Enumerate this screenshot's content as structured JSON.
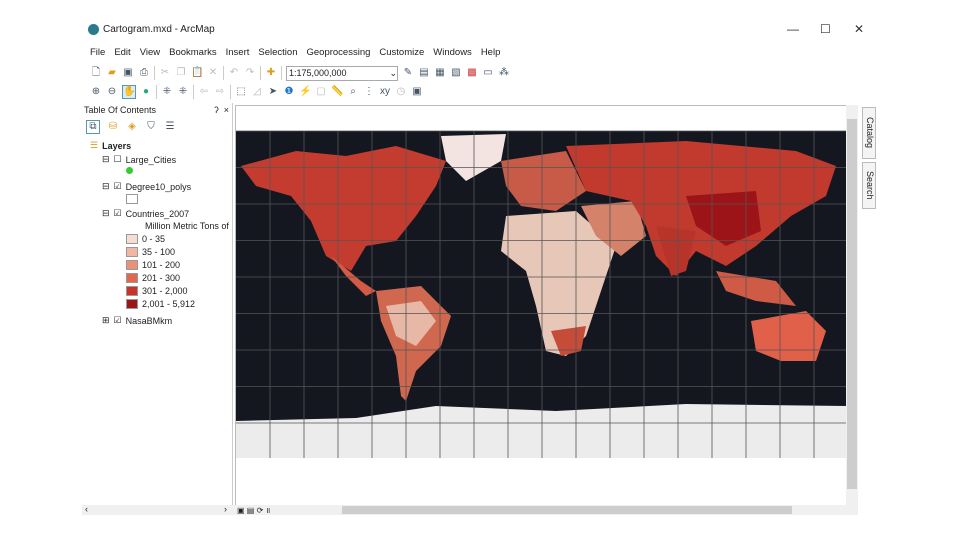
{
  "window": {
    "title": "Cartogram.mxd - ArcMap",
    "minimize": "—",
    "maximize": "☐",
    "close": "✕"
  },
  "menu": [
    "File",
    "Edit",
    "View",
    "Bookmarks",
    "Insert",
    "Selection",
    "Geoprocessing",
    "Customize",
    "Windows",
    "Help"
  ],
  "toolbar": {
    "scale": "1:175,000,000"
  },
  "toc": {
    "title": "Table Of Contents",
    "pin": "ʔ",
    "close": "×",
    "root": "Layers",
    "layers": [
      {
        "name": "Large_Cities",
        "checked": false
      },
      {
        "name": "Degree10_polys",
        "checked": true
      },
      {
        "name": "Countries_2007",
        "checked": true
      },
      {
        "name": "NasaBMkm",
        "checked": true
      }
    ],
    "legend_title": "Million Metric Tons of",
    "legend": [
      {
        "label": "0 - 35",
        "color": "#f6dcd4"
      },
      {
        "label": "35 - 100",
        "color": "#f0b8a4"
      },
      {
        "label": "101 - 200",
        "color": "#ec9178"
      },
      {
        "label": "201 - 300",
        "color": "#e4664e"
      },
      {
        "label": "301 - 2,000",
        "color": "#cc3028"
      },
      {
        "label": "2,001 - 5,912",
        "color": "#9c1418"
      }
    ]
  },
  "side_tabs": [
    "Catalog",
    "Search"
  ]
}
